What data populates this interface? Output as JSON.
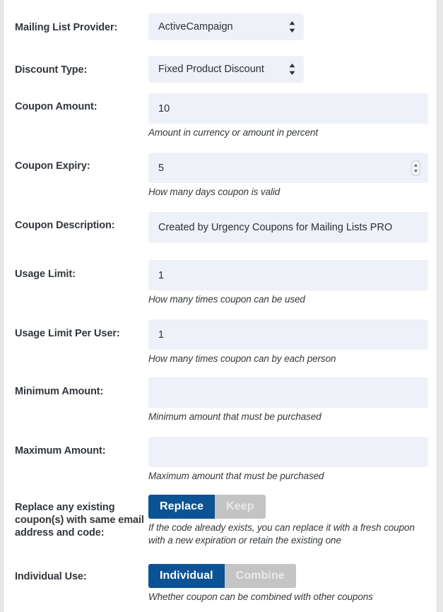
{
  "theme": {
    "accent": "#0b5394",
    "inactive": "#c4c4c4",
    "field_bg": "#eef1f7",
    "label_color": "#32373c",
    "page_bg": "#ffffff"
  },
  "form": {
    "rows": [
      {
        "id": "mailing-list-provider",
        "label": "Mailing List Provider:",
        "type": "select",
        "value": "ActiveCampaign",
        "help": ""
      },
      {
        "id": "discount-type",
        "label": "Discount Type:",
        "type": "select",
        "value": "Fixed Product Discount",
        "help": ""
      },
      {
        "id": "coupon-amount",
        "label": "Coupon Amount:",
        "type": "text",
        "value": "10",
        "placeholder": "",
        "help": "Amount in currency or amount in percent"
      },
      {
        "id": "coupon-expiry",
        "label": "Coupon Expiry:",
        "type": "number",
        "value": "5",
        "placeholder": "",
        "help": "How many days coupon is valid"
      },
      {
        "id": "coupon-description",
        "label": "Coupon Description:",
        "type": "text",
        "value": "Created by Urgency Coupons for Mailing Lists PRO",
        "placeholder": "",
        "help": ""
      },
      {
        "id": "usage-limit",
        "label": "Usage Limit:",
        "type": "text",
        "value": "1",
        "placeholder": "",
        "help": "How many times coupon can be used"
      },
      {
        "id": "usage-limit-per-user",
        "label": "Usage Limit Per User:",
        "type": "text",
        "value": "1",
        "placeholder": "",
        "help": "How many times coupon can by each person"
      },
      {
        "id": "minimum-amount",
        "label": "Minimum Amount:",
        "type": "text",
        "value": "",
        "placeholder": "",
        "help": "Minimum amount that must be purchased"
      },
      {
        "id": "maximum-amount",
        "label": "Maximum Amount:",
        "type": "text",
        "value": "",
        "placeholder": "",
        "help": "Maximum amount that must be purchased"
      },
      {
        "id": "replace-existing-coupons",
        "label": "Replace any existing coupon(s) with same email address and code:",
        "type": "toggle",
        "options": [
          "Replace",
          "Keep"
        ],
        "selected": "Replace",
        "help": "If the code already exists, you can replace it with a fresh coupon with a new expiration or retain the existing one"
      },
      {
        "id": "individual-use",
        "label": "Individual Use:",
        "type": "toggle",
        "options": [
          "Individual",
          "Combine"
        ],
        "selected": "Individual",
        "help": "Whether coupon can be combined with other coupons"
      }
    ]
  },
  "icons": {
    "select_arrows": "sort-arrows-icon",
    "number_spinner": "number-spinner-icon"
  }
}
